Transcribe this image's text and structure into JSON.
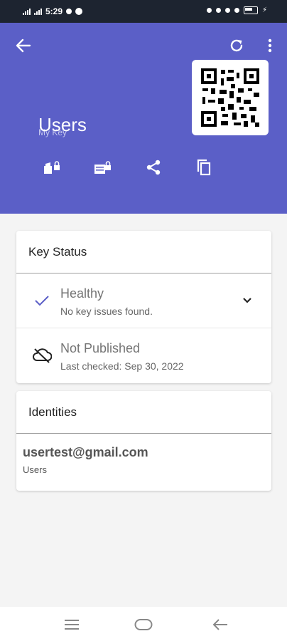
{
  "status_bar": {
    "time": "5:29",
    "battery": "65"
  },
  "header": {
    "title": "Users",
    "subtitle": "My Key",
    "background_color": "#5b5fc7",
    "icons": [
      "back-arrow-icon",
      "refresh-icon",
      "more-vert-icon",
      "qr-code-icon"
    ]
  },
  "actions": [
    "encrypt-icon",
    "sign-icon",
    "share-icon",
    "copy-icon"
  ],
  "key_status": {
    "heading": "Key Status",
    "rows": [
      {
        "icon": "check-icon",
        "title": "Healthy",
        "subtitle": "No key issues found."
      },
      {
        "icon": "cloud-off-icon",
        "title": "Not Published",
        "subtitle": "Last checked: Sep 30, 2022"
      }
    ]
  },
  "identities": {
    "heading": "Identities",
    "items": [
      {
        "email": "usertest@gmail.com",
        "name": "Users"
      }
    ]
  },
  "nav": [
    "menu-icon",
    "home-icon",
    "back-icon"
  ]
}
